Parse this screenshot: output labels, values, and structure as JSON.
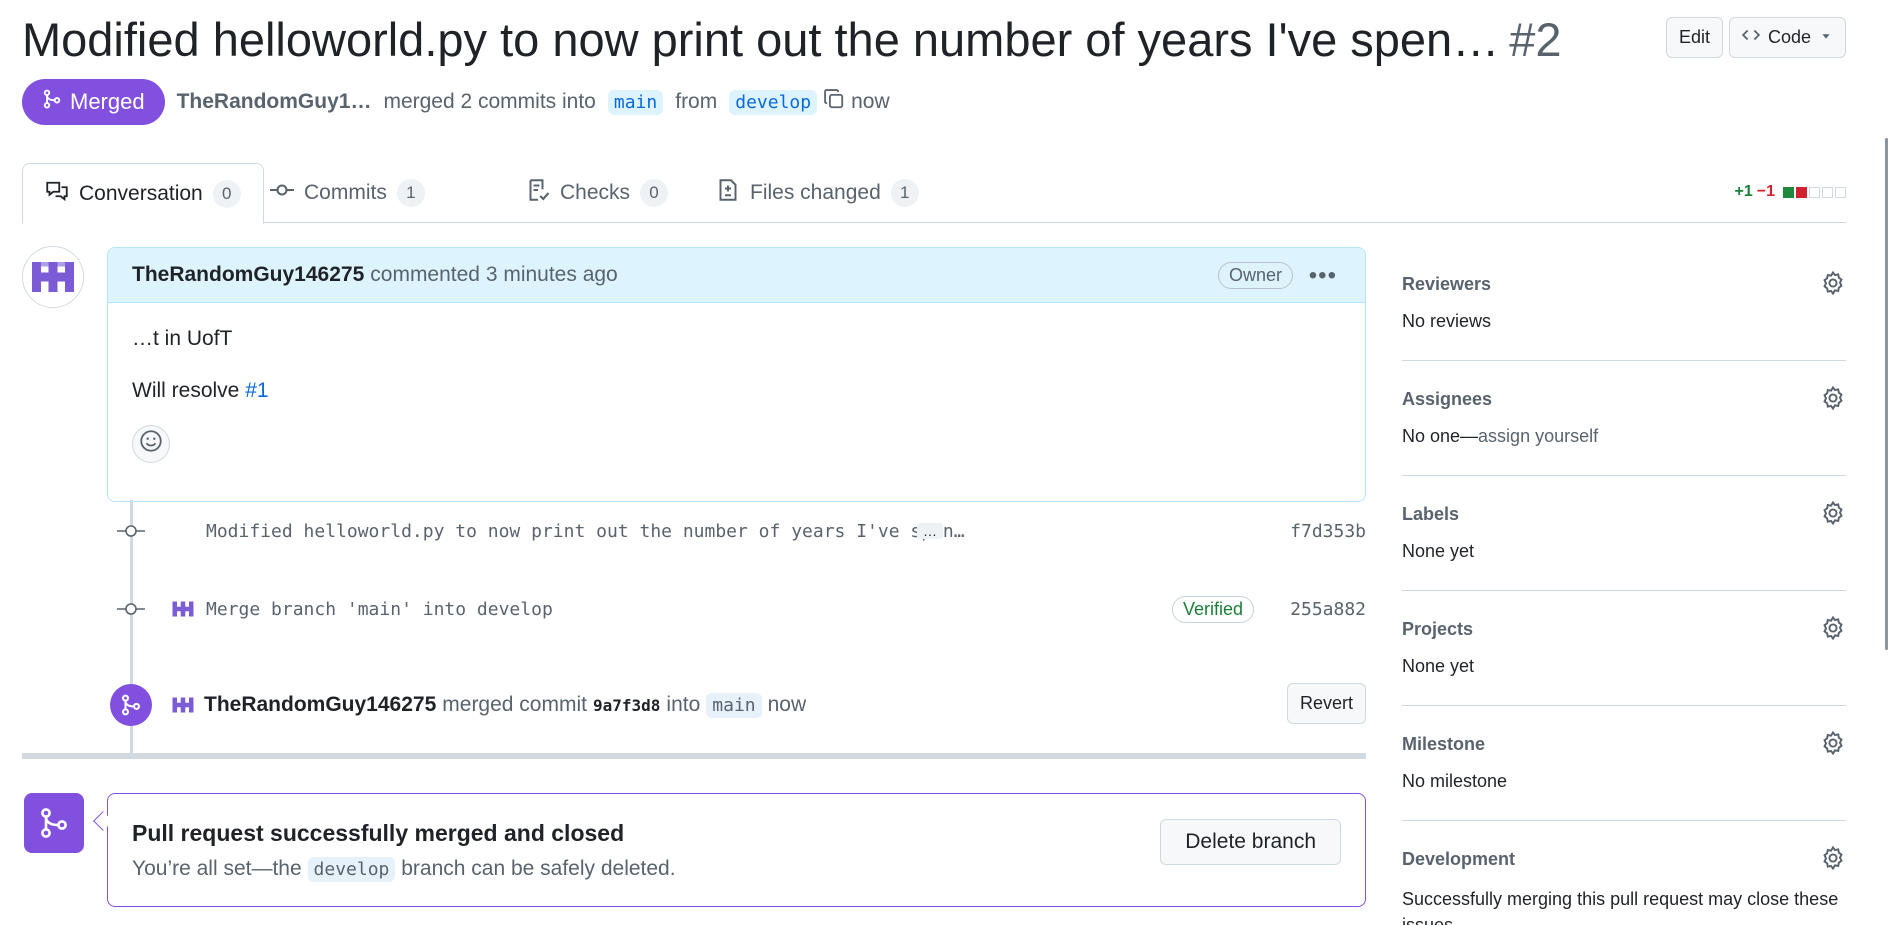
{
  "header": {
    "title": "Modified helloworld.py to now print out the number of years I've spen…",
    "number": "#2",
    "edit_label": "Edit",
    "code_label": "Code"
  },
  "meta": {
    "state": "Merged",
    "author": "TheRandomGuy1…",
    "action": "merged 2 commits into",
    "base_branch": "main",
    "from": "from",
    "head_branch": "develop",
    "time": "now"
  },
  "tabs": [
    {
      "label": "Conversation",
      "count": "0",
      "icon": "comment-discussion-icon"
    },
    {
      "label": "Commits",
      "count": "1",
      "icon": "git-commit-icon"
    },
    {
      "label": "Checks",
      "count": "0",
      "icon": "checklist-icon"
    },
    {
      "label": "Files changed",
      "count": "1",
      "icon": "file-diff-icon"
    }
  ],
  "diffstat": {
    "additions": "+1",
    "deletions": "−1"
  },
  "comment": {
    "author": "TheRandomGuy146275",
    "action": "commented 3 minutes ago",
    "badge": "Owner",
    "line1": "…t in UofT",
    "line2_prefix": "Will resolve",
    "issue_link": "#1"
  },
  "commits": [
    {
      "message": "Modified helloworld.py to now print out the number of years I've spen…",
      "ellipsis": "…",
      "sha": "f7d353b"
    },
    {
      "message": "Merge branch 'main' into develop",
      "verified": "Verified",
      "sha": "255a882"
    }
  ],
  "merge_event": {
    "author": "TheRandomGuy146275",
    "action": "merged commit",
    "sha": "9a7f3d8",
    "into": "into",
    "branch": "main",
    "time": "now",
    "revert_label": "Revert"
  },
  "merged_box": {
    "title": "Pull request successfully merged and closed",
    "text_prefix": "You’re all set—the",
    "branch": "develop",
    "text_suffix": "branch can be safely deleted.",
    "delete_label": "Delete branch"
  },
  "sidebar": {
    "reviewers": {
      "title": "Reviewers",
      "value": "No reviews"
    },
    "assignees": {
      "title": "Assignees",
      "value": "No one—",
      "link": "assign yourself"
    },
    "labels": {
      "title": "Labels",
      "value": "None yet"
    },
    "projects": {
      "title": "Projects",
      "value": "None yet"
    },
    "milestone": {
      "title": "Milestone",
      "value": "No milestone"
    },
    "development": {
      "title": "Development",
      "value": "Successfully merging this pull request may close these issues."
    }
  },
  "colors": {
    "merged": "#8250df",
    "link": "#0969da",
    "add": "#1a7f37",
    "delete": "#d1242f"
  }
}
